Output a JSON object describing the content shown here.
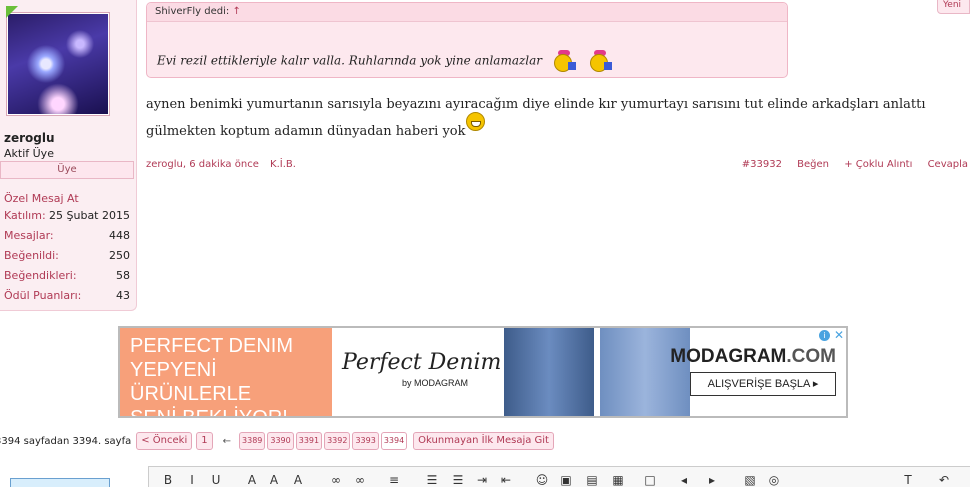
{
  "user": {
    "name": "zeroglu",
    "title": "Aktif Üye",
    "rank": "Üye",
    "pm_link": "Özel Mesaj At",
    "stats": [
      {
        "label": "Katılım:",
        "value": "25 Şubat 2015"
      },
      {
        "label": "Mesajlar:",
        "value": "448"
      },
      {
        "label": "Beğenildi:",
        "value": "250"
      },
      {
        "label": "Beğendikleri:",
        "value": "58"
      },
      {
        "label": "Ödül Puanları:",
        "value": "43"
      }
    ]
  },
  "quote": {
    "author_line": "ShiverFly dedi:",
    "arrow": "↑",
    "text": "Evi rezil ettikleriyle kalır valla. Ruhlarında yok yine anlamazlar"
  },
  "message": {
    "line1": "aynen benimki yumurtanın sarısıyla beyazını ayıracağım diye elinde kır yumurtayı sarısını tut elinde arkadşları anlattı",
    "line2": "gülmekten koptum adamın dünyadan haberi yok"
  },
  "meta": {
    "author": "zeroglu",
    "time": "6 dakika önce",
    "kib": "K.İ.B.",
    "post_no": "#33932",
    "like": "Beğen",
    "multi_quote": "+ Çoklu Alıntı",
    "reply": "Cevapla"
  },
  "new_tab": "Yeni",
  "ad": {
    "left_text": [
      "PERFECT DENIM",
      "YEPYENİ ÜRÜNLERLE",
      "SENİ BEKLİYOR!"
    ],
    "brand": "Perfect Denim",
    "brand_sub": "by MODAGRAM",
    "logo_main": "MODAGRAM",
    "logo_suffix": ".COM",
    "cta": "ALIŞVERİŞE BAŞLA ▸",
    "info": "i",
    "close": "✕"
  },
  "pagination": {
    "label": "3394 sayfadan 3394. sayfa",
    "prev": "< Önceki",
    "first": "1",
    "dash": "←",
    "pages": [
      "3389",
      "3390",
      "3391",
      "3392",
      "3393",
      "3394"
    ],
    "unread": "Okunmayan İlk Mesaja Git"
  },
  "toolbar": {
    "icons": [
      {
        "name": "bold-icon",
        "glyph": "B"
      },
      {
        "name": "italic-icon",
        "glyph": "I"
      },
      {
        "name": "underline-icon",
        "glyph": "U"
      },
      {
        "name": "font-icon",
        "glyph": "A"
      },
      {
        "name": "font-size-icon",
        "glyph": "A"
      },
      {
        "name": "font-color-icon",
        "glyph": "A"
      },
      {
        "name": "link-icon",
        "glyph": "∞"
      },
      {
        "name": "unlink-icon",
        "glyph": "∞"
      },
      {
        "name": "align-icon",
        "glyph": "≡"
      },
      {
        "name": "list-icon",
        "glyph": "☰"
      },
      {
        "name": "numbered-list-icon",
        "glyph": "☰"
      },
      {
        "name": "indent-icon",
        "glyph": "⇥"
      },
      {
        "name": "outdent-icon",
        "glyph": "⇤"
      },
      {
        "name": "smiley-icon",
        "glyph": "☺"
      },
      {
        "name": "image-icon",
        "glyph": "▣"
      },
      {
        "name": "media-icon",
        "glyph": "▤"
      },
      {
        "name": "insert-icon",
        "glyph": "▦"
      },
      {
        "name": "box-icon",
        "glyph": "□"
      },
      {
        "name": "undo-icon",
        "glyph": "◂"
      },
      {
        "name": "redo-icon",
        "glyph": "▸"
      },
      {
        "name": "preview-icon",
        "glyph": "▧"
      },
      {
        "name": "camera-icon",
        "glyph": "◎"
      },
      {
        "name": "remove-format-icon",
        "glyph": "T"
      },
      {
        "name": "source-icon",
        "glyph": "↶"
      }
    ]
  },
  "colors": {
    "accent": "#b03a55",
    "pink_bg": "#fde8ee",
    "border": "#efb6c6"
  }
}
